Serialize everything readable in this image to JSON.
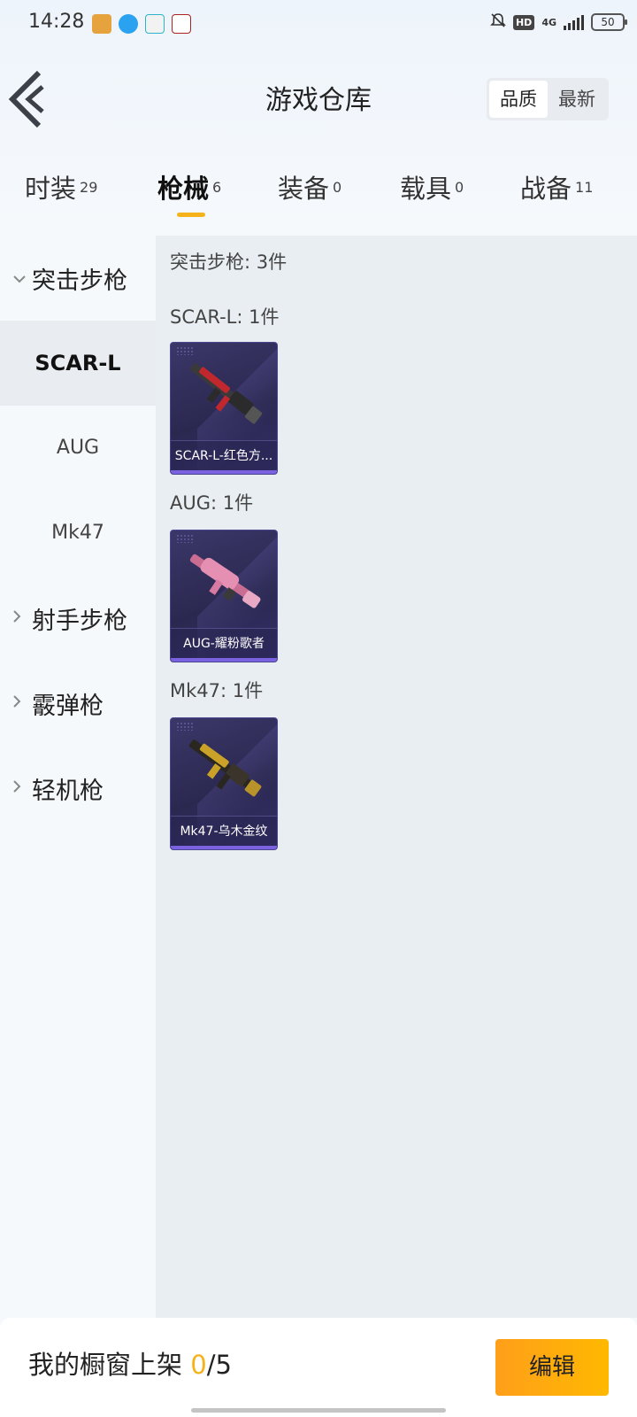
{
  "status_bar": {
    "time": "14:28",
    "network": "4G",
    "hd_label": "HD",
    "battery": "50",
    "app_icons": [
      "game-app-icon",
      "qq-icon",
      "sign-in-app-icon",
      "mask-app-icon"
    ]
  },
  "header": {
    "title": "游戏仓库",
    "sort_options": [
      "品质",
      "最新"
    ],
    "active_sort": "品质"
  },
  "tabs": [
    {
      "label": "时装",
      "count": "29"
    },
    {
      "label": "枪械",
      "count": "6"
    },
    {
      "label": "装备",
      "count": "0"
    },
    {
      "label": "载具",
      "count": "0"
    },
    {
      "label": "战备",
      "count": "11"
    }
  ],
  "active_tab": "枪械",
  "left_nav": {
    "groups": [
      {
        "label": "突击步枪",
        "expanded": true,
        "items": [
          "SCAR-L",
          "AUG",
          "Mk47"
        ]
      },
      {
        "label": "射手步枪",
        "expanded": false
      },
      {
        "label": "霰弹枪",
        "expanded": false
      },
      {
        "label": "轻机枪",
        "expanded": false
      }
    ],
    "active_item": "SCAR-L"
  },
  "content": {
    "summary": "突击步枪: 3件",
    "sections": [
      {
        "title": "SCAR-L: 1件",
        "items": [
          {
            "name": "SCAR-L-红色方...",
            "accent": "#c0282d"
          }
        ]
      },
      {
        "title": "AUG: 1件",
        "items": [
          {
            "name": "AUG-耀粉歌者",
            "accent": "#e58fb3"
          }
        ]
      },
      {
        "title": "Mk47: 1件",
        "items": [
          {
            "name": "Mk47-乌木金纹",
            "accent": "#c9a227"
          }
        ]
      }
    ]
  },
  "bottom_bar": {
    "label": "我的橱窗上架",
    "current": "0",
    "total": "/5",
    "edit_label": "编辑"
  },
  "colors": {
    "accent_yellow": "#f5b21a",
    "edit_button": "#ffac12",
    "card_bg": "#2f2b58"
  }
}
